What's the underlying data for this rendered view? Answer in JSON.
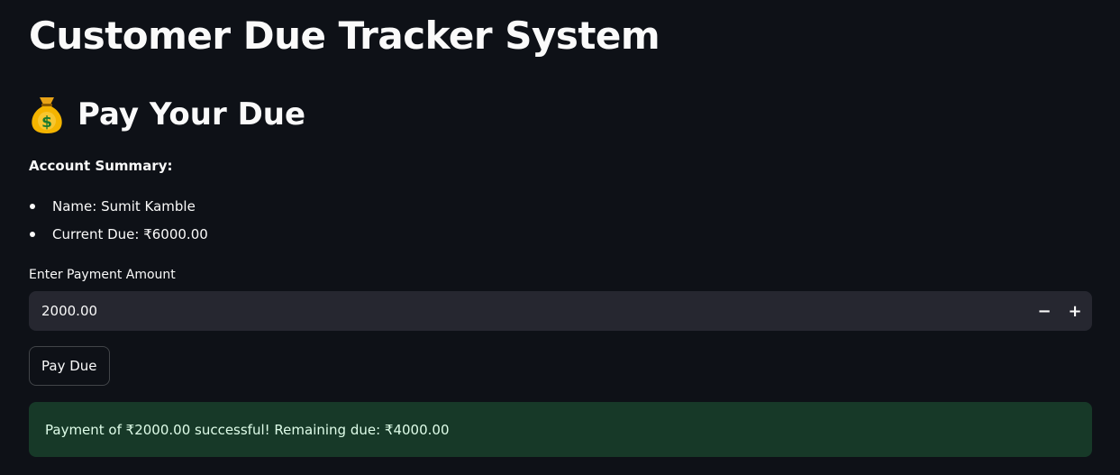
{
  "app": {
    "title": "Customer Due Tracker System"
  },
  "section": {
    "icon": "money-bag-icon",
    "title": "Pay Your Due"
  },
  "summary": {
    "label": "Account Summary:",
    "items": [
      "Name: Sumit Kamble",
      "Current Due: ₹6000.00"
    ]
  },
  "payment_input": {
    "label": "Enter Payment Amount",
    "value": "2000.00",
    "decrement_symbol": "−",
    "increment_symbol": "+"
  },
  "pay_button": {
    "label": "Pay Due"
  },
  "success_message": {
    "text": "Payment of ₹2000.00 successful! Remaining due: ₹4000.00"
  },
  "colors": {
    "background": "#0e1117",
    "input_background": "#262730",
    "success_background": "#173928",
    "text": "#fafafa"
  }
}
